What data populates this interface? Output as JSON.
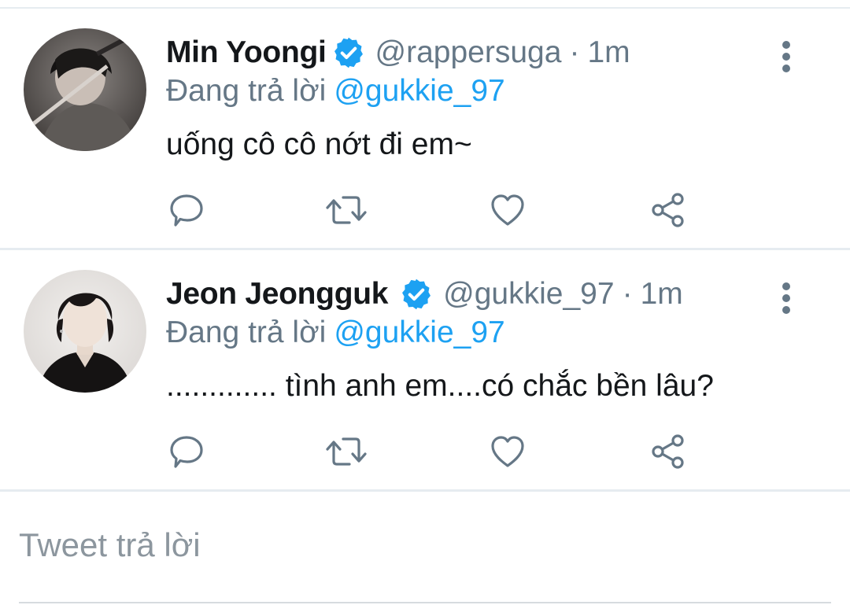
{
  "tweets": [
    {
      "name": "Min Yoongi",
      "handle": "@rappersuga",
      "separator": "·",
      "time": "1m",
      "reply_prefix": "Đang trả lời",
      "reply_mention": "@gukkie_97",
      "text": "uống cô cô nớt đi em~",
      "avatar_icon": "avatar-photo",
      "verified": true
    },
    {
      "name": "Jeon Jeongguk",
      "handle": "@gukkie_97",
      "separator": "·",
      "time": "1m",
      "reply_prefix": "Đang trả lời",
      "reply_mention": "@gukkie_97",
      "text": "............. tình anh em....có chắc bền lâu?",
      "avatar_icon": "avatar-photo",
      "verified": true
    }
  ],
  "actions": {
    "reply_icon": "reply-icon",
    "retweet_icon": "retweet-icon",
    "like_icon": "heart-icon",
    "share_icon": "share-icon"
  },
  "reply_box": {
    "placeholder": "Tweet trả lời"
  },
  "colors": {
    "link": "#1da1f2",
    "secondary_text": "#657786",
    "icon": "#657786",
    "divider": "#e6ecf0"
  }
}
